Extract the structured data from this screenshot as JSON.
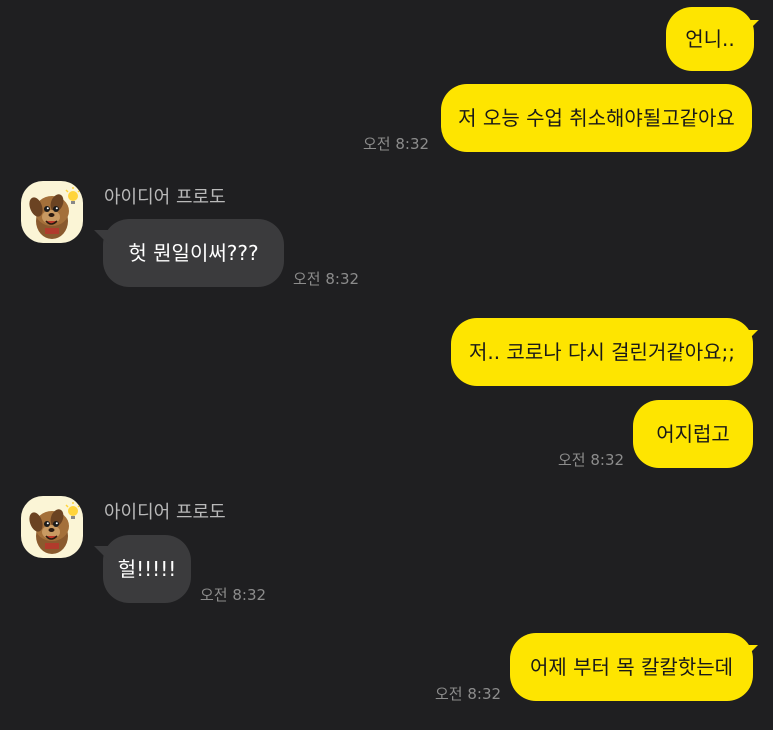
{
  "colors": {
    "background": "#1f1f21",
    "outgoing_bubble": "#fee500",
    "incoming_bubble": "#3b3b3d",
    "timestamp": "#8c8c8c"
  },
  "messages": [
    {
      "direction": "out",
      "text": "언니..",
      "time": ""
    },
    {
      "direction": "out",
      "text": "저 오능 수업 취소해야될고같아요",
      "time": "오전 8:32"
    },
    {
      "direction": "in",
      "sender": "아이디어 프로도",
      "avatar_icon": "frodo-dog-avatar-icon",
      "text": "헛 뭔일이써???",
      "time": "오전 8:32"
    },
    {
      "direction": "out",
      "text": "저.. 코로나 다시 걸린거같아요;;",
      "time": ""
    },
    {
      "direction": "out",
      "text": "어지럽고",
      "time": "오전 8:32"
    },
    {
      "direction": "in",
      "sender": "아이디어 프로도",
      "avatar_icon": "frodo-dog-avatar-icon",
      "text": "헐!!!!!",
      "time": "오전 8:32"
    },
    {
      "direction": "out",
      "text": "어제 부터 목 칼칼핫는데",
      "time": "오전 8:32"
    }
  ]
}
